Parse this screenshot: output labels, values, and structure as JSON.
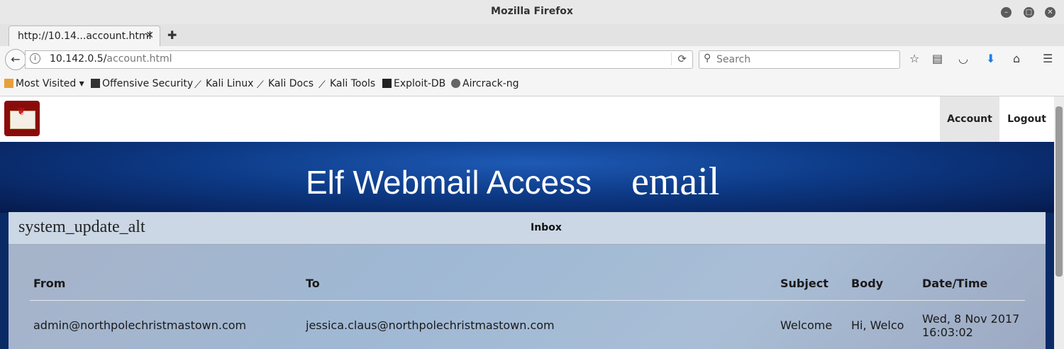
{
  "window": {
    "title": "Mozilla Firefox"
  },
  "tabs": [
    {
      "title": "http://10.14...account.html"
    }
  ],
  "nav": {
    "url_host": "10.142.0.5/",
    "url_path": "account.html",
    "search_placeholder": "Search"
  },
  "bookmarks": [
    {
      "label": "Most Visited ▾"
    },
    {
      "label": "Offensive Security"
    },
    {
      "label": "Kali Linux"
    },
    {
      "label": "Kali Docs"
    },
    {
      "label": "Kali Tools"
    },
    {
      "label": "Exploit-DB"
    },
    {
      "label": "Aircrack-ng"
    }
  ],
  "site": {
    "nav_account": "Account",
    "nav_logout": "Logout",
    "hero_title": "Elf Webmail Access",
    "hero_icon_text": "email"
  },
  "inbox": {
    "icon_text": "system_update_alt",
    "title": "Inbox",
    "columns": [
      "From",
      "To",
      "Subject",
      "Body",
      "Date/Time"
    ],
    "rows": [
      {
        "from": "admin@northpolechristmastown.com",
        "to": "jessica.claus@northpolechristmastown.com",
        "subject": "Welcome",
        "body": "Hi, Welco",
        "datetime": "Wed, 8 Nov 2017 16:03:02"
      }
    ]
  },
  "colors": {
    "hero_dark": "#061a4d",
    "hero_light": "#1e5ab5",
    "logo_red": "#8b0b0b"
  }
}
